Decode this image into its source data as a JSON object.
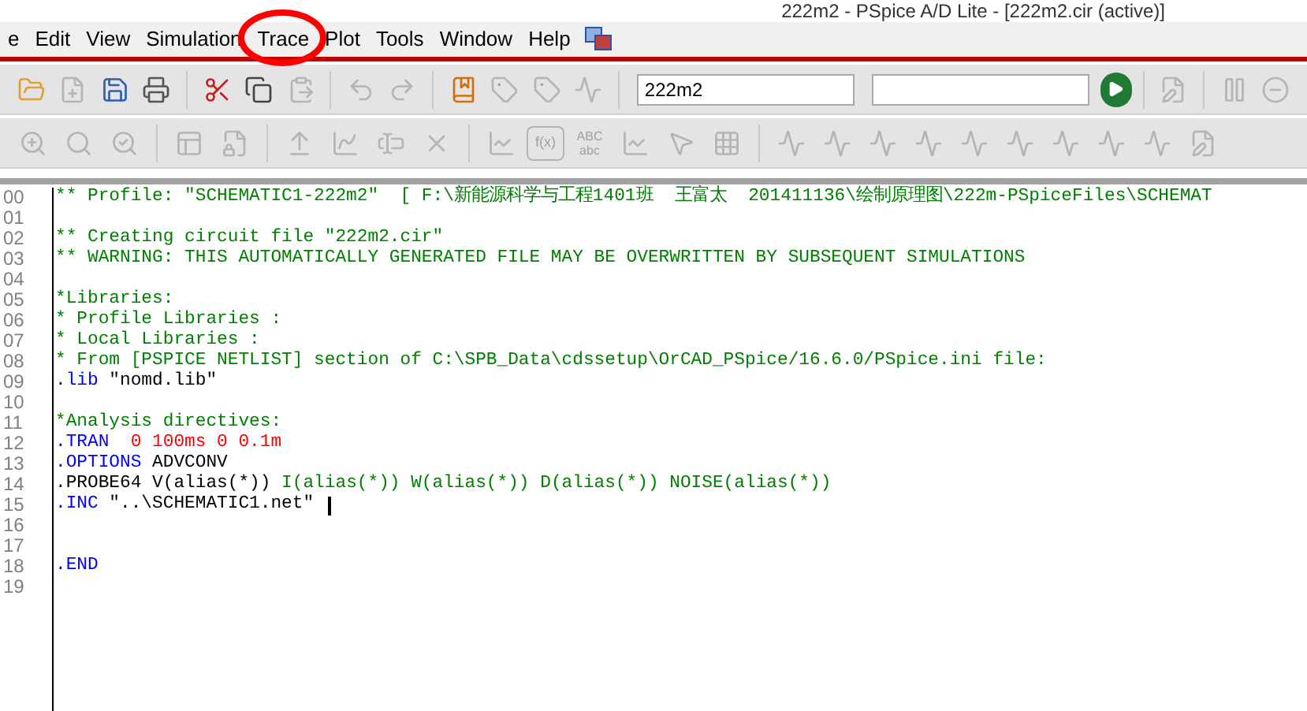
{
  "window": {
    "title": "222m2 - PSpice A/D Lite - [222m2.cir (active)]"
  },
  "menu": [
    "e",
    "Edit",
    "View",
    "Simulation",
    "Trace",
    "Plot",
    "Tools",
    "Window",
    "Help"
  ],
  "toolbar_1": [
    {
      "kind": "folder",
      "disabled": false
    },
    {
      "kind": "file-plus",
      "disabled": true
    },
    {
      "kind": "save",
      "disabled": false
    },
    {
      "kind": "printer",
      "disabled": false
    },
    {
      "kind": "separator"
    },
    {
      "kind": "scissors",
      "disabled": false
    },
    {
      "kind": "copy",
      "disabled": false
    },
    {
      "kind": "clipboard",
      "disabled": true
    },
    {
      "kind": "separator"
    },
    {
      "kind": "undo",
      "disabled": true
    },
    {
      "kind": "redo",
      "disabled": true
    },
    {
      "kind": "separator"
    },
    {
      "kind": "bookmark",
      "disabled": false
    },
    {
      "kind": "tag",
      "disabled": true
    },
    {
      "kind": "tag",
      "disabled": true
    },
    {
      "kind": "activity",
      "disabled": true
    },
    {
      "kind": "separator"
    },
    {
      "kind": "field",
      "value": "222m2"
    },
    {
      "kind": "field"
    },
    {
      "kind": "run",
      "disabled": false
    },
    {
      "kind": "separator"
    },
    {
      "kind": "pencil-file",
      "disabled": true
    },
    {
      "kind": "separator"
    },
    {
      "kind": "pause",
      "disabled": true
    },
    {
      "kind": "minus-circle",
      "disabled": true
    }
  ],
  "toolbar_2": [
    {
      "kind": "zoom-in",
      "disabled": true
    },
    {
      "kind": "search",
      "disabled": true
    },
    {
      "kind": "search-check",
      "disabled": true
    },
    {
      "kind": "separator"
    },
    {
      "kind": "panel",
      "disabled": true
    },
    {
      "kind": "file-lock",
      "disabled": true
    },
    {
      "kind": "separator"
    },
    {
      "kind": "y-axis",
      "disabled": true
    },
    {
      "kind": "spline",
      "disabled": true
    },
    {
      "kind": "text-cursor",
      "disabled": true
    },
    {
      "kind": "x",
      "disabled": true
    },
    {
      "kind": "separator"
    },
    {
      "kind": "line-chart",
      "disabled": true
    },
    {
      "kind": "fx",
      "label": "f(x)",
      "disabled": true
    },
    {
      "kind": "abc",
      "label": "ABC",
      "label_2": "abc",
      "disabled": true
    },
    {
      "kind": "line-chart",
      "disabled": true
    },
    {
      "kind": "pointer",
      "disabled": true
    },
    {
      "kind": "grid",
      "disabled": true
    },
    {
      "kind": "separator"
    },
    {
      "kind": "activity",
      "disabled": true
    },
    {
      "kind": "activity",
      "disabled": true
    },
    {
      "kind": "activity",
      "disabled": true
    },
    {
      "kind": "activity",
      "disabled": true
    },
    {
      "kind": "activity",
      "disabled": true
    },
    {
      "kind": "activity",
      "disabled": true
    },
    {
      "kind": "activity",
      "disabled": true
    },
    {
      "kind": "activity",
      "disabled": true
    },
    {
      "kind": "activity",
      "disabled": true
    },
    {
      "kind": "pencil-file",
      "disabled": true
    }
  ],
  "annotation": {
    "shown": true
  },
  "editor": {
    "lines": [
      {
        "number": "00",
        "segments": [
          {
            "kind": "comment",
            "text": "** Profile: \"SCHEMATIC1-222m2\"  [ F:\\新能源科学与工程1401班  王富太  201411136\\绘制原理图\\222m-PSpiceFiles\\SCHEMAT"
          }
        ]
      },
      {
        "number": "01"
      },
      {
        "number": "02",
        "segments": [
          {
            "kind": "comment",
            "text": "** Creating circuit file \"222m2.cir\""
          }
        ]
      },
      {
        "number": "03",
        "segments": [
          {
            "kind": "comment",
            "text": "** WARNING: THIS AUTOMATICALLY GENERATED FILE MAY BE OVERWRITTEN BY SUBSEQUENT SIMULATIONS"
          }
        ]
      },
      {
        "number": "04"
      },
      {
        "number": "05",
        "segments": [
          {
            "kind": "comment",
            "text": "*Libraries:"
          }
        ]
      },
      {
        "number": "06",
        "segments": [
          {
            "kind": "comment",
            "text": "* Profile Libraries :"
          }
        ]
      },
      {
        "number": "07",
        "segments": [
          {
            "kind": "comment",
            "text": "* Local Libraries :"
          }
        ]
      },
      {
        "number": "08",
        "segments": [
          {
            "kind": "comment",
            "text": "* From [PSPICE NETLIST] section of C:\\SPB_Data\\cdssetup\\OrCAD_PSpice/16.6.0/PSpice.ini file:"
          }
        ]
      },
      {
        "number": "09",
        "segments": [
          {
            "kind": "keyword",
            "text": ".lib"
          },
          {
            "kind": "plain",
            "text": " \"nomd.lib\""
          }
        ]
      },
      {
        "number": "10"
      },
      {
        "number": "11",
        "segments": [
          {
            "kind": "comment",
            "text": "*Analysis directives:"
          }
        ]
      },
      {
        "number": "12",
        "segments": [
          {
            "kind": "keyword",
            "text": ".TRAN"
          },
          {
            "kind": "value",
            "text": "  0 100ms 0 0.1m"
          }
        ]
      },
      {
        "number": "13",
        "segments": [
          {
            "kind": "keyword",
            "text": ".OPTIONS"
          },
          {
            "kind": "plain",
            "text": " ADVCONV"
          }
        ]
      },
      {
        "number": "14",
        "segments": [
          {
            "kind": "plain",
            "text": ".PROBE64 V(alias(*))"
          },
          {
            "kind": "comment",
            "text": " I(alias(*)) W(alias(*)) D(alias(*)) NOISE(alias(*))"
          }
        ]
      },
      {
        "number": "15",
        "segments": [
          {
            "kind": "keyword",
            "text": ".INC"
          },
          {
            "kind": "plain",
            "text": " \"..\\SCHEMATIC1.net\" "
          }
        ],
        "cursor": true
      },
      {
        "number": "16"
      },
      {
        "number": "17"
      },
      {
        "number": "18",
        "segments": [
          {
            "kind": "keyword",
            "text": ".END"
          }
        ]
      },
      {
        "number": "19"
      }
    ]
  }
}
